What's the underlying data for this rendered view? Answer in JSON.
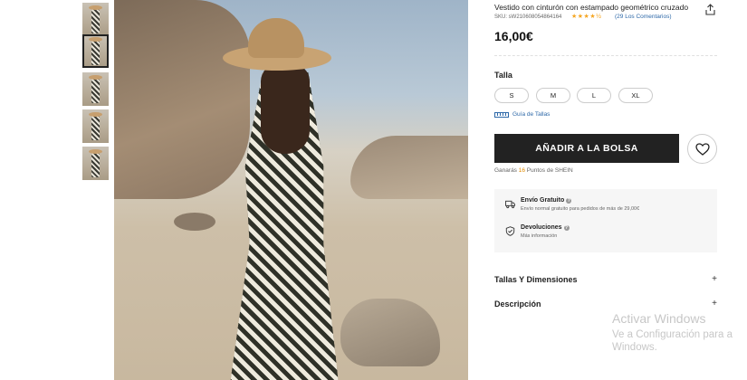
{
  "product": {
    "title": "Vestido con cinturón con estampado geométrico cruzado",
    "sku": "SKU: sW2106080548641​64",
    "rating_stars": "★★★★½",
    "reviews": "(29 Los Comentarios)",
    "price": "16,00€"
  },
  "size": {
    "label": "Talla",
    "options": [
      "S",
      "M",
      "L",
      "XL"
    ],
    "guide": "Guía de Tallas"
  },
  "actions": {
    "add_to_bag": "AÑADIR A LA BOLSA",
    "points_prefix": "Ganarás ",
    "points_value": "16",
    "points_suffix": " Puntos de SHEIN"
  },
  "shipping": {
    "title": "Envío Gratuito",
    "subtitle": "Envío normal gratuito para pedidos de más de 29,00€"
  },
  "returns": {
    "title": "Devoluciones",
    "subtitle": "Más información"
  },
  "accordions": [
    {
      "label": "Tallas Y Dimensiones",
      "icon": "+"
    },
    {
      "label": "Descripción",
      "icon": "+"
    }
  ],
  "watermark": {
    "line1": "Activar Windows",
    "line2": "Ve a Configuración para a",
    "line3": "Windows."
  },
  "icons": {
    "share": "share-icon",
    "wishlist": "heart-icon",
    "ruler": "ruler-icon",
    "truck": "truck-icon",
    "shield": "shield-check-icon"
  },
  "colors": {
    "accent_blue": "#2d68a8",
    "button_dark": "#222222",
    "stars": "#f5a623",
    "points": "#e08a00"
  }
}
